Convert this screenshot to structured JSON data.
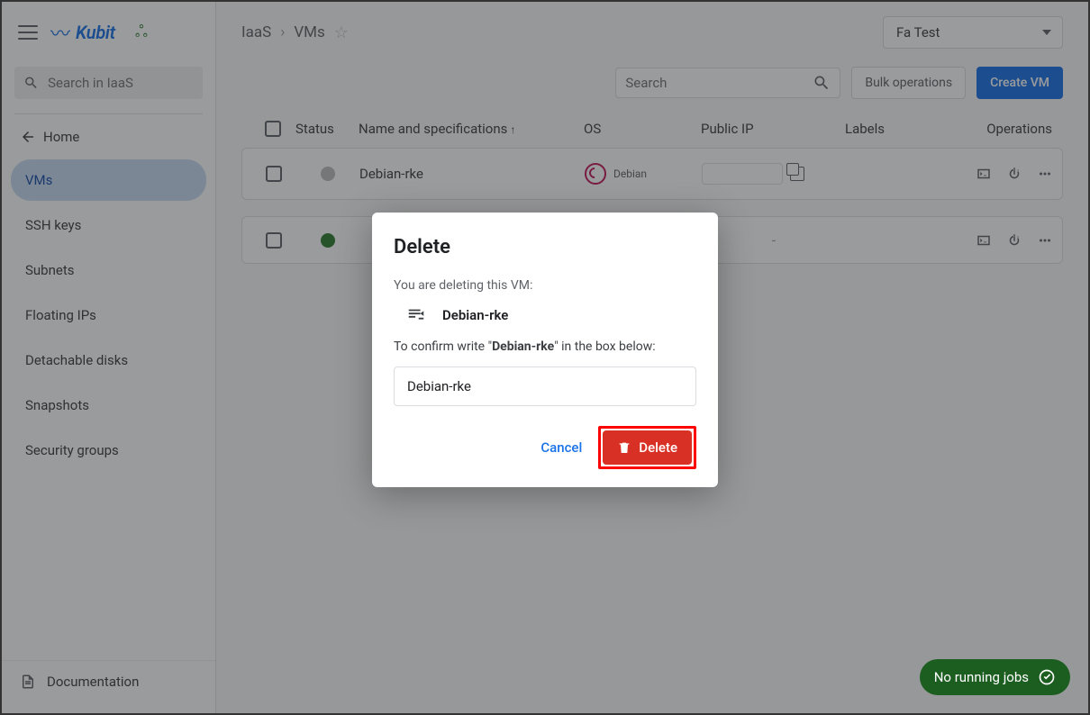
{
  "brand": {
    "name": "Kubit"
  },
  "sidebar": {
    "search_placeholder": "Search in IaaS",
    "home_label": "Home",
    "items": [
      {
        "label": "VMs"
      },
      {
        "label": "SSH keys"
      },
      {
        "label": "Subnets"
      },
      {
        "label": "Floating IPs"
      },
      {
        "label": "Detachable disks"
      },
      {
        "label": "Snapshots"
      },
      {
        "label": "Security groups"
      }
    ],
    "documentation_label": "Documentation"
  },
  "breadcrumb": {
    "section": "IaaS",
    "page": "VMs"
  },
  "project_selector": {
    "value": "Fa Test"
  },
  "toolbar": {
    "search_placeholder": "Search",
    "bulk_label": "Bulk operations",
    "create_label": "Create VM"
  },
  "table": {
    "columns": {
      "status": "Status",
      "name": "Name and specifications",
      "os": "OS",
      "public_ip": "Public IP",
      "labels": "Labels",
      "operations": "Operations"
    },
    "rows": [
      {
        "status": "grey",
        "name": "Debian-rke",
        "os_name": "Debian",
        "public_ip": "",
        "labels": ""
      },
      {
        "status": "green",
        "name": "",
        "os_name": "",
        "public_ip": "-",
        "labels": ""
      }
    ]
  },
  "modal": {
    "title": "Delete",
    "subtitle": "You are deleting this VM:",
    "vm_name": "Debian-rke",
    "confirm_prefix": "To confirm write \"",
    "confirm_suffix": "\" in the box below:",
    "input_value": "Debian-rke",
    "cancel_label": "Cancel",
    "delete_label": "Delete"
  },
  "jobs_pill": {
    "label": "No running jobs"
  }
}
